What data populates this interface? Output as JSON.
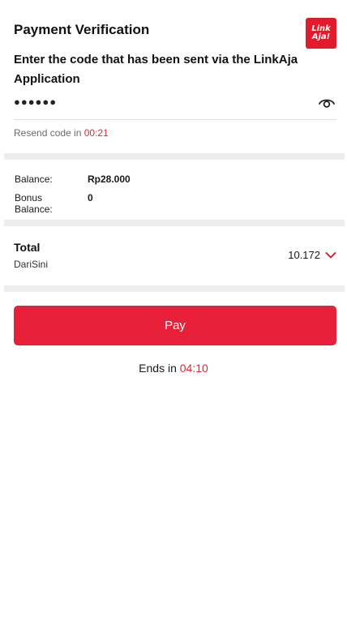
{
  "header": {
    "title": "Payment Verification",
    "logo_line1": "Link",
    "logo_line2": "Aja!"
  },
  "verification": {
    "instruction": "Enter the code that has been sent via the LinkAja Application",
    "otp_value": "●●●●●●",
    "resend_label": "Resend code in ",
    "resend_timer": "00:21",
    "eye_icon": "eye-icon"
  },
  "balance": {
    "label": "Balance:",
    "value": "Rp28.000",
    "bonus_label": "Bonus Balance:",
    "bonus_value": "0"
  },
  "total": {
    "label": "Total",
    "merchant": "DariSini",
    "amount": "10.172",
    "chevron_icon": "chevron-down-icon"
  },
  "actions": {
    "pay_label": "Pay"
  },
  "footer": {
    "ends_label": "Ends in ",
    "ends_timer": "04:10"
  },
  "colors": {
    "accent": "#e8203a",
    "timer": "#c8313b",
    "divider": "#ededed"
  }
}
